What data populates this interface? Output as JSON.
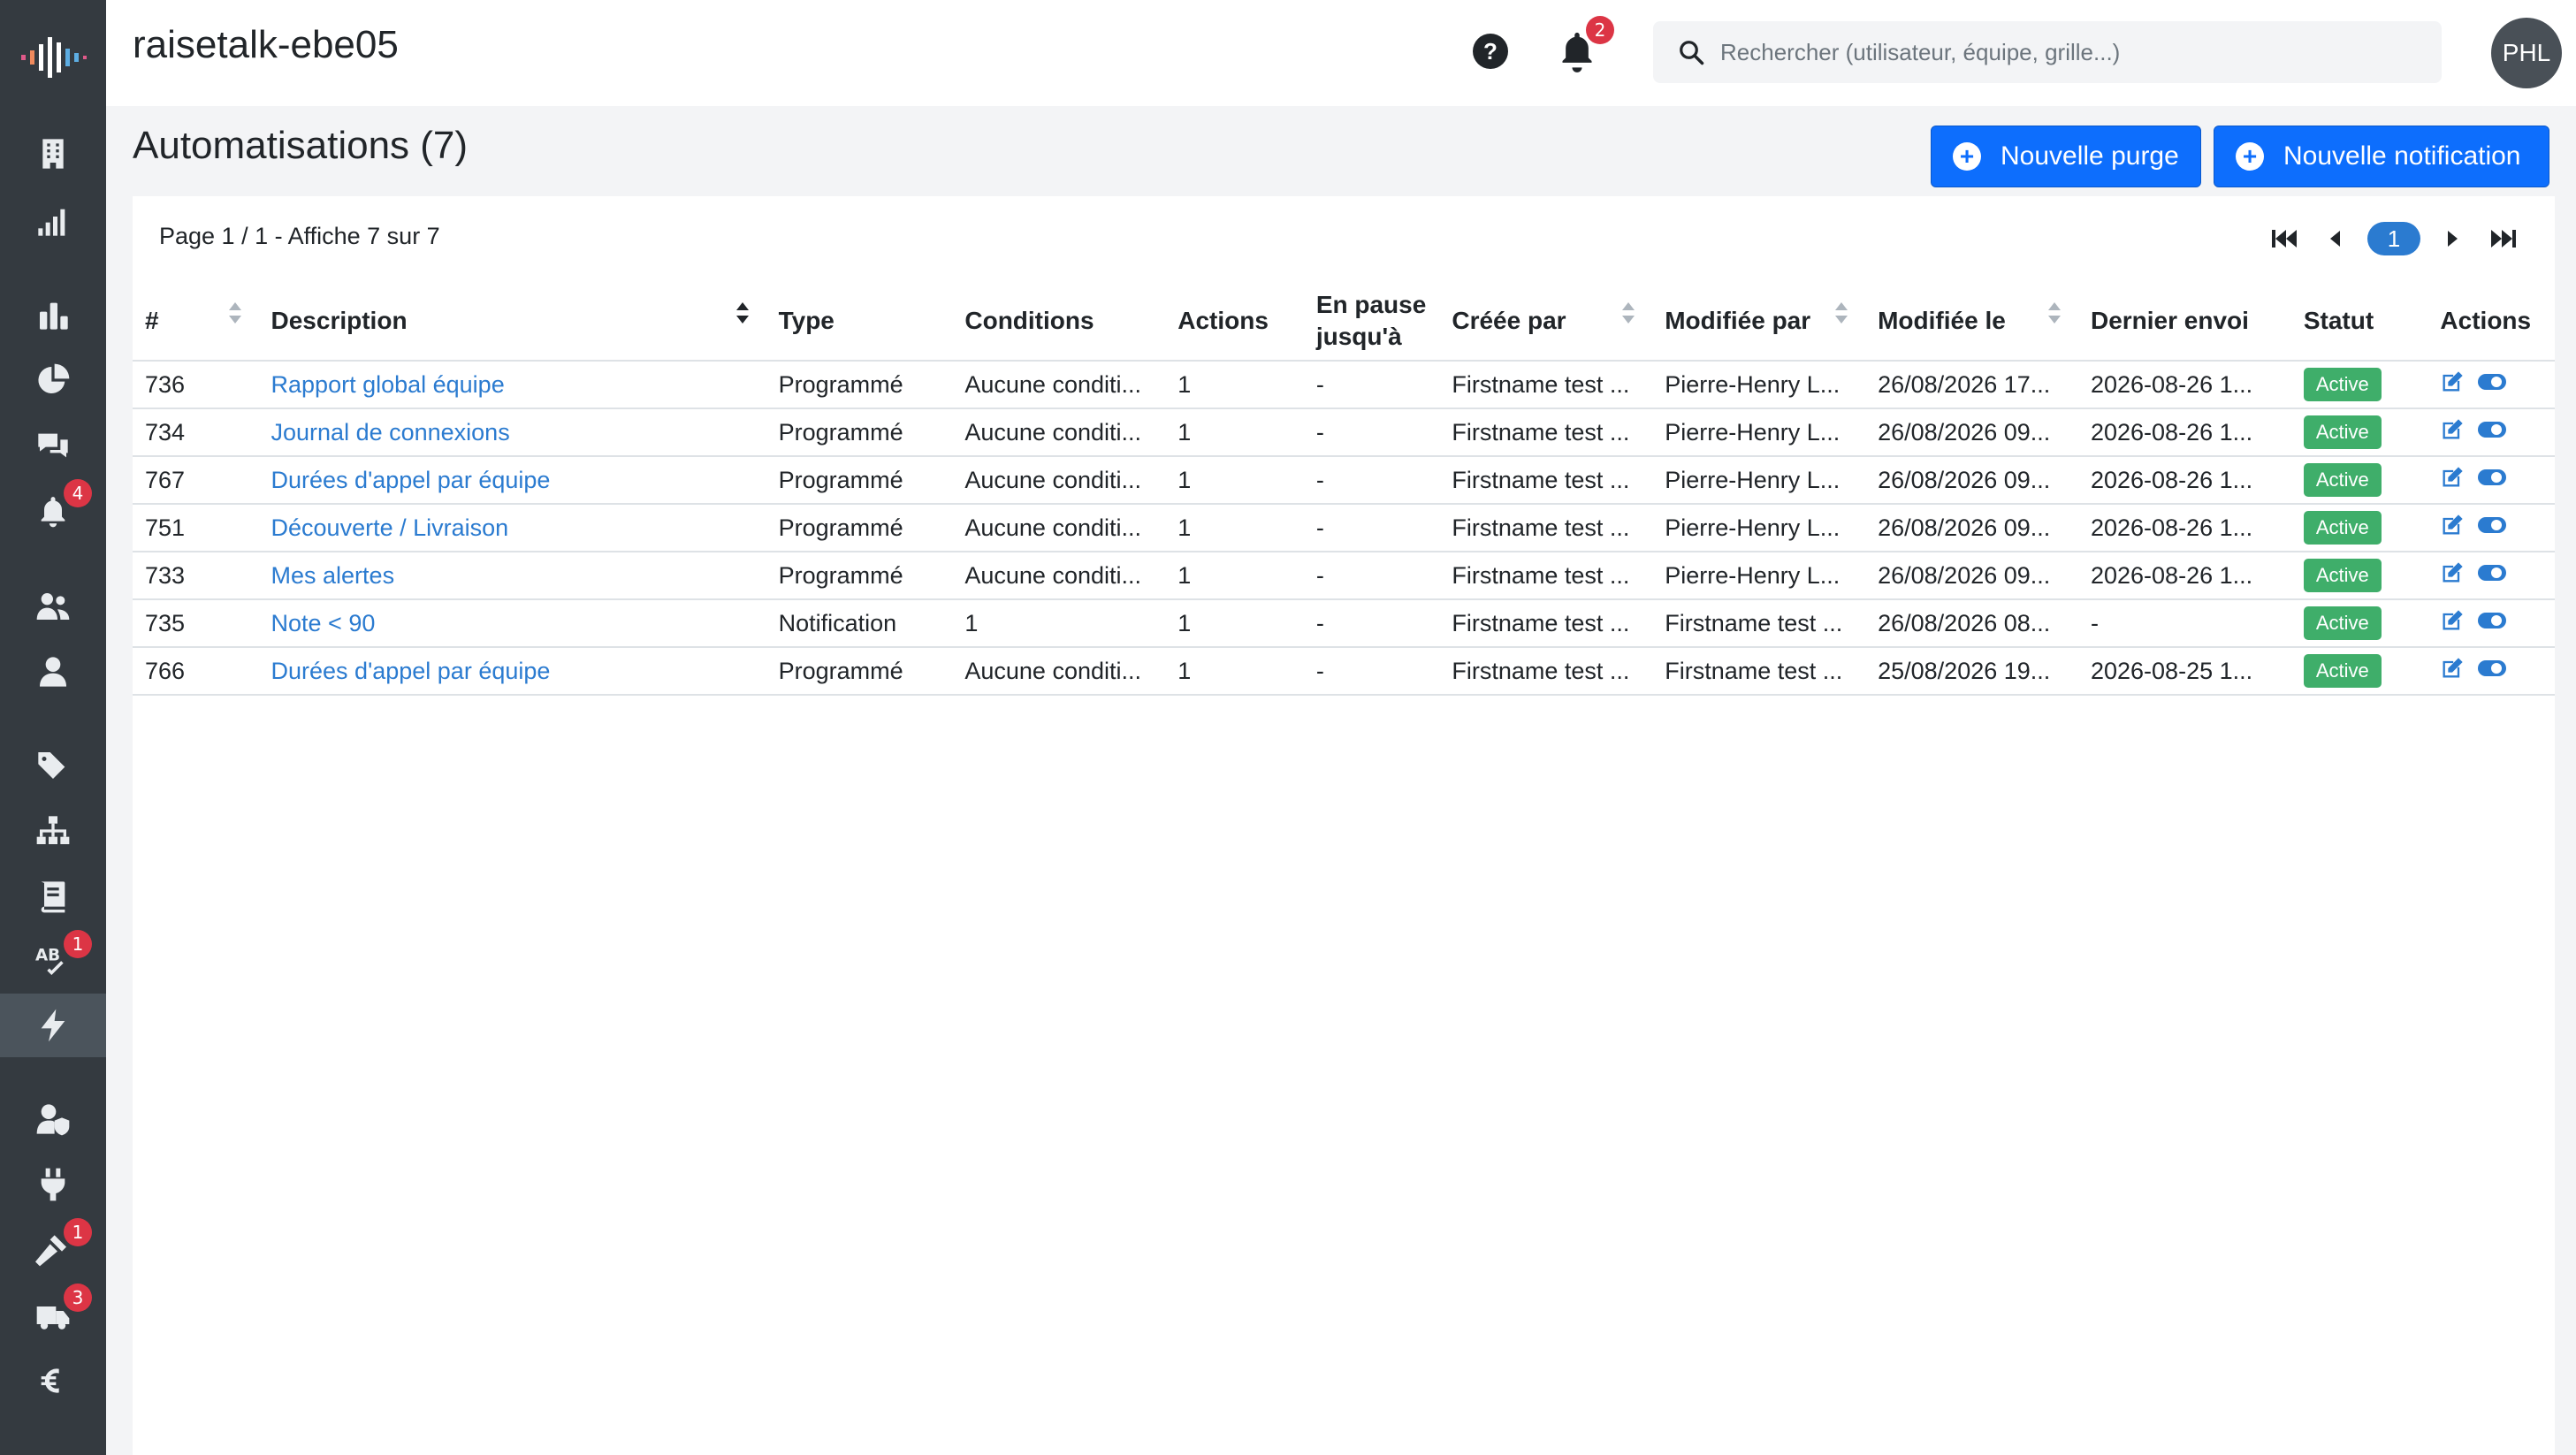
{
  "header": {
    "app_name": "raisetalk-ebe05",
    "help_label": "?",
    "notifications_count": "2",
    "search_placeholder": "Rechercher (utilisateur, équipe, grille...)",
    "avatar_initials": "PHL"
  },
  "sidebar": {
    "items": [
      {
        "name": "building-icon",
        "badge": ""
      },
      {
        "name": "signal-bars-icon",
        "badge": ""
      },
      {
        "name": "bar-chart-icon",
        "badge": ""
      },
      {
        "name": "pie-chart-icon",
        "badge": ""
      },
      {
        "name": "comments-icon",
        "badge": ""
      },
      {
        "name": "bell-icon",
        "badge": "4"
      },
      {
        "name": "users-icon",
        "badge": ""
      },
      {
        "name": "user-icon",
        "badge": ""
      },
      {
        "name": "tags-icon",
        "badge": ""
      },
      {
        "name": "sitemap-icon",
        "badge": ""
      },
      {
        "name": "book-icon",
        "badge": ""
      },
      {
        "name": "spellcheck-icon",
        "badge": "1"
      },
      {
        "name": "bolt-icon",
        "badge": "",
        "active": true
      },
      {
        "name": "user-shield-icon",
        "badge": ""
      },
      {
        "name": "plug-icon",
        "badge": ""
      },
      {
        "name": "gavel-icon",
        "badge": "1"
      },
      {
        "name": "ambulance-icon",
        "badge": "3"
      },
      {
        "name": "euro-icon",
        "badge": ""
      }
    ]
  },
  "page": {
    "title": "Automatisations (7)",
    "new_purge_label": "Nouvelle purge",
    "new_notification_label": "Nouvelle notification"
  },
  "pagination": {
    "info": "Page 1 / 1 - Affiche 7 sur 7",
    "current_page": "1"
  },
  "table": {
    "headers": {
      "id": "#",
      "description": "Description",
      "type": "Type",
      "conditions": "Conditions",
      "actions_count": "Actions",
      "paused_until_1": "En pause",
      "paused_until_2": "jusqu'à",
      "created_by": "Créée par",
      "modified_by": "Modifiée par",
      "modified_at": "Modifiée le",
      "last_sent": "Dernier envoi",
      "status": "Statut",
      "row_actions": "Actions"
    },
    "rows": [
      {
        "id": "736",
        "description": "Rapport global équipe",
        "type": "Programmé",
        "conditions": "Aucune conditi...",
        "actions": "1",
        "paused": "-",
        "created_by": "Firstname test ...",
        "modified_by": "Pierre-Henry L...",
        "modified_at": "26/08/2026 17...",
        "last_sent": "2026-08-26 1...",
        "status": "Active"
      },
      {
        "id": "734",
        "description": "Journal de connexions",
        "type": "Programmé",
        "conditions": "Aucune conditi...",
        "actions": "1",
        "paused": "-",
        "created_by": "Firstname test ...",
        "modified_by": "Pierre-Henry L...",
        "modified_at": "26/08/2026 09...",
        "last_sent": "2026-08-26 1...",
        "status": "Active"
      },
      {
        "id": "767",
        "description": "Durées d'appel par équipe",
        "type": "Programmé",
        "conditions": "Aucune conditi...",
        "actions": "1",
        "paused": "-",
        "created_by": "Firstname test ...",
        "modified_by": "Pierre-Henry L...",
        "modified_at": "26/08/2026 09...",
        "last_sent": "2026-08-26 1...",
        "status": "Active"
      },
      {
        "id": "751",
        "description": "Découverte / Livraison",
        "type": "Programmé",
        "conditions": "Aucune conditi...",
        "actions": "1",
        "paused": "-",
        "created_by": "Firstname test ...",
        "modified_by": "Pierre-Henry L...",
        "modified_at": "26/08/2026 09...",
        "last_sent": "2026-08-26 1...",
        "status": "Active"
      },
      {
        "id": "733",
        "description": "Mes alertes",
        "type": "Programmé",
        "conditions": "Aucune conditi...",
        "actions": "1",
        "paused": "-",
        "created_by": "Firstname test ...",
        "modified_by": "Pierre-Henry L...",
        "modified_at": "26/08/2026 09...",
        "last_sent": "2026-08-26 1...",
        "status": "Active"
      },
      {
        "id": "735",
        "description": "Note < 90",
        "type": "Notification",
        "conditions": "1",
        "actions": "1",
        "paused": "-",
        "created_by": "Firstname test ...",
        "modified_by": "Firstname test ...",
        "modified_at": "26/08/2026 08...",
        "last_sent": "-",
        "status": "Active"
      },
      {
        "id": "766",
        "description": "Durées d'appel par équipe",
        "type": "Programmé",
        "conditions": "Aucune conditi...",
        "actions": "1",
        "paused": "-",
        "created_by": "Firstname test ...",
        "modified_by": "Firstname test ...",
        "modified_at": "25/08/2026 19...",
        "last_sent": "2026-08-25 1...",
        "status": "Active"
      }
    ]
  },
  "colors": {
    "sidebar_bg": "#343a40",
    "primary": "#0d6efd",
    "link": "#2b7bd0",
    "status_active": "#3fae6a",
    "badge": "#dc3545"
  }
}
